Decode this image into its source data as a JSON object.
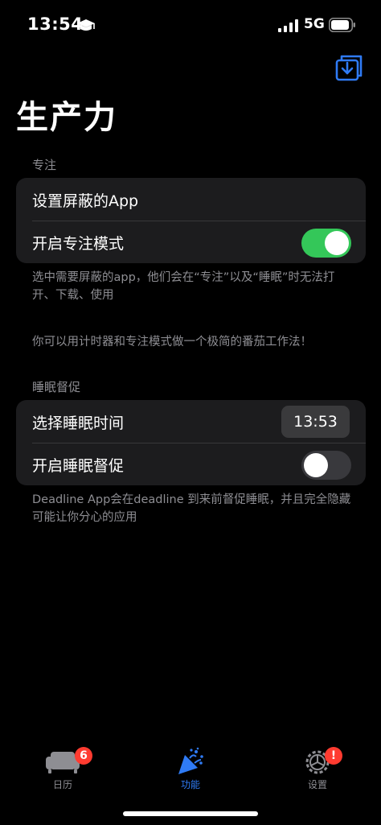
{
  "status_bar": {
    "time": "13:54",
    "network": "5G"
  },
  "page": {
    "title": "生产力"
  },
  "focus_section": {
    "header": "专注",
    "rows": [
      {
        "label": "设置屏蔽的App"
      },
      {
        "label": "开启专注模式",
        "toggle": true
      }
    ],
    "footnote": "选中需要屏蔽的app，他们会在“专注”以及“睡眠”时无法打开、下载、使用",
    "tip": "你可以用计时器和专注模式做一个极简的番茄工作法！"
  },
  "sleep_section": {
    "header": "睡眠督促",
    "rows": [
      {
        "label": "选择睡眠时间",
        "value": "13:53"
      },
      {
        "label": "开启睡眠督促",
        "toggle": false
      }
    ],
    "footnote": "Deadline App会在deadline 到来前督促睡眠，并且完全隐藏可能让你分心的应用"
  },
  "tab_bar": {
    "tabs": [
      {
        "label": "日历",
        "icon": "sofa-icon",
        "badge": "6"
      },
      {
        "label": "功能",
        "icon": "party-popper-icon",
        "active": true
      },
      {
        "label": "设置",
        "icon": "gear-icon",
        "badge": "!"
      }
    ]
  },
  "colors": {
    "accent": "#2f7bf5",
    "toggle_on": "#34c759",
    "badge": "#ff3b30",
    "cell_bg": "#1c1c1e"
  }
}
